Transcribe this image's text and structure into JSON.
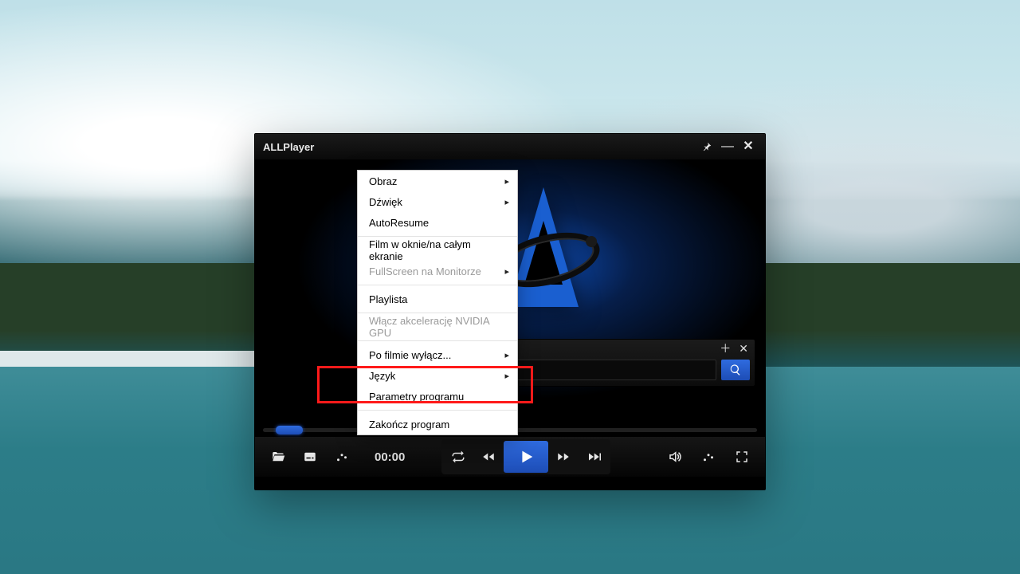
{
  "app": {
    "title": "ALLPlayer"
  },
  "window_buttons": {
    "pin": "⟟",
    "minimize": "—",
    "close": "✕"
  },
  "context_menu": {
    "items": [
      {
        "label": "Obraz",
        "submenu": true,
        "disabled": false
      },
      {
        "label": "Dźwięk",
        "submenu": true,
        "disabled": false
      },
      {
        "label": "AutoResume",
        "submenu": false,
        "disabled": false
      },
      {
        "sep": true
      },
      {
        "label": "Film w oknie/na całym ekranie",
        "submenu": false,
        "disabled": false
      },
      {
        "label": "FullScreen na Monitorze",
        "submenu": true,
        "disabled": true
      },
      {
        "sep": true
      },
      {
        "label": "Playlista",
        "submenu": false,
        "disabled": false
      },
      {
        "sep": true
      },
      {
        "label": "Włącz akcelerację NVIDIA GPU",
        "submenu": false,
        "disabled": true
      },
      {
        "sep": true
      },
      {
        "label": "Po filmie wyłącz...",
        "submenu": true,
        "disabled": false
      },
      {
        "label": "Język",
        "submenu": true,
        "disabled": false
      },
      {
        "label": "Parametry programu",
        "submenu": false,
        "disabled": false,
        "highlighted": true
      },
      {
        "sep": true
      },
      {
        "label": "Zakończ program",
        "submenu": false,
        "disabled": false
      }
    ]
  },
  "float_panel": {
    "add": "＋",
    "close": "✕",
    "search_value": "",
    "search_placeholder": ""
  },
  "playback": {
    "time": "00:00",
    "progress_percent": 5
  },
  "icons": {
    "open": "open-folder-icon",
    "subtitles": "subtitles-icon",
    "equalizer": "sliders-icon",
    "shuffle": "repeat-icon",
    "prev": "rewind-icon",
    "play": "play-icon",
    "next": "fast-forward-icon",
    "skip": "skip-next-icon",
    "volume": "volume-icon",
    "audio_eq": "audio-sliders-icon",
    "fullscreen": "fullscreen-icon",
    "search": "search-icon",
    "pin": "pin-icon",
    "minimize": "minimize-icon",
    "closewin": "close-icon"
  }
}
